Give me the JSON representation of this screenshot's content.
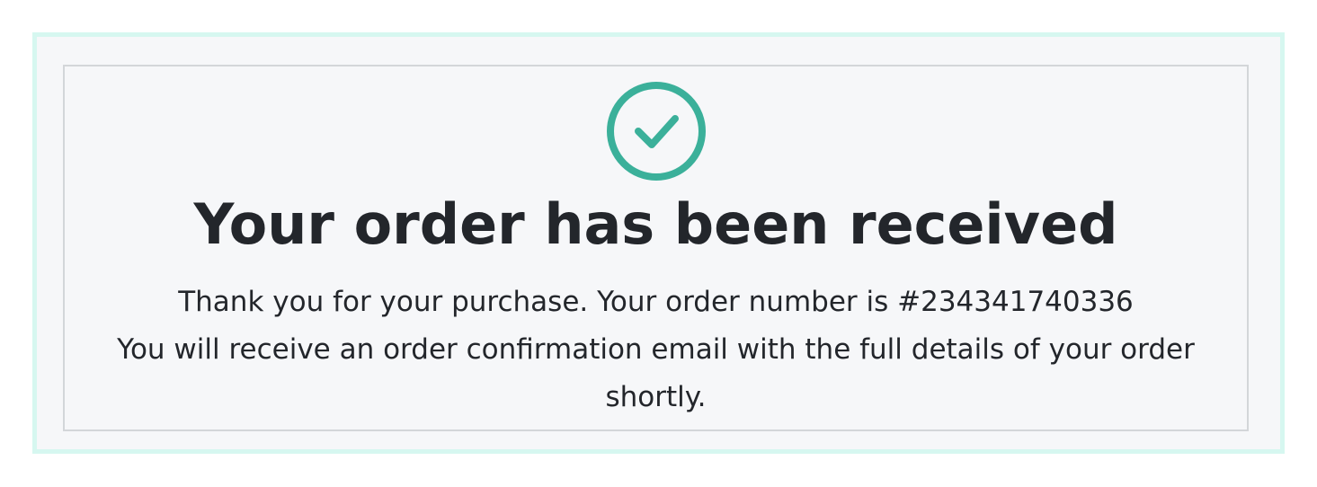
{
  "confirmation": {
    "icon": "check-circle-icon",
    "accent_color": "#3bb09a",
    "title": "Your order has been received",
    "thank_you_prefix": "Thank you for your purchase. Your order number is ",
    "order_number": "#234341740336",
    "email_notice": "You will receive an order confirmation email with the full details of your order shortly."
  }
}
